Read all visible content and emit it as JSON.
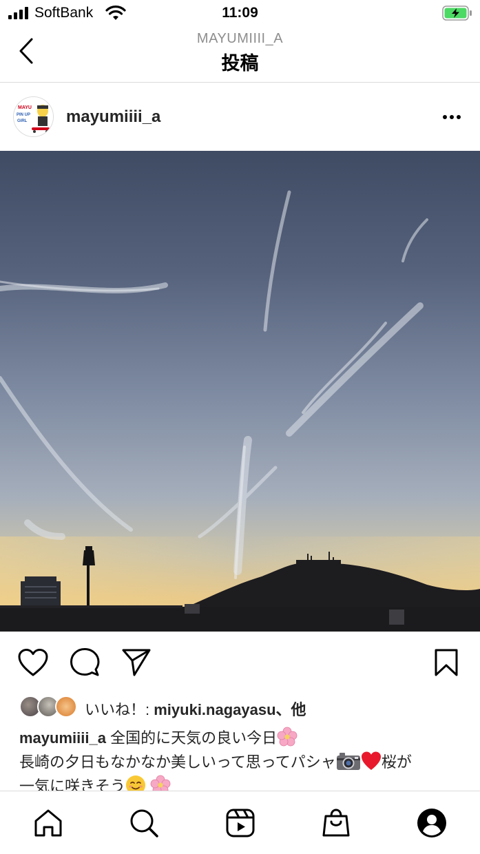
{
  "status_bar": {
    "carrier": "SoftBank",
    "time": "11:09",
    "icons": [
      "signal-bars-icon",
      "wifi-icon",
      "battery-charging-icon"
    ]
  },
  "header": {
    "username": "MAYUMIIII_A",
    "title": "投稿",
    "back_icon": "chevron-left-icon"
  },
  "post": {
    "username": "mayumiiii_a",
    "more_icon": "more-horizontal-icon",
    "photo": "sunset-sky-over-mountain-silhouette"
  },
  "actions": {
    "icons": [
      "heart-icon",
      "comment-icon",
      "share-icon",
      "bookmark-icon"
    ]
  },
  "likes": {
    "prefix": "いいね！: ",
    "user": "miyuki.nagayasu",
    "suffix": "、他"
  },
  "caption": {
    "username": "mayumiiii_a",
    "part1": " 全国的に天気の良い今日",
    "part2": "長崎の夕日もなかなか美しいって思ってパシャ",
    "part3": "桜が",
    "part4": "一気に咲きそう"
  },
  "tab_bar": {
    "icons": [
      "home-icon",
      "search-icon",
      "reels-icon",
      "shop-icon",
      "profile-icon"
    ]
  },
  "colors": {
    "text": "#262626",
    "secondary": "#8e8e8e",
    "divider": "#dbdbdb",
    "battery_green": "#4cd964"
  }
}
